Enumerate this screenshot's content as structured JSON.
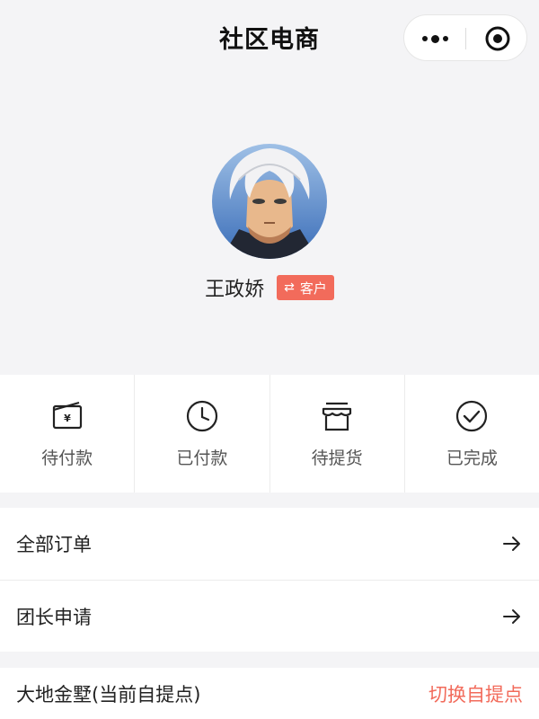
{
  "header": {
    "title": "社区电商",
    "more_icon": "more-dots-icon",
    "close_icon": "target-circle-icon"
  },
  "profile": {
    "name": "王政娇",
    "role_icon": "swap-icon",
    "role_badge": "客户",
    "badge_color": "#f26b5b"
  },
  "order_status": [
    {
      "label": "待付款",
      "icon": "wallet-yen-icon"
    },
    {
      "label": "已付款",
      "icon": "clock-icon"
    },
    {
      "label": "待提货",
      "icon": "store-icon"
    },
    {
      "label": "已完成",
      "icon": "check-circle-icon"
    }
  ],
  "menu": [
    {
      "label": "全部订单",
      "icon": "arrow-right-icon"
    },
    {
      "label": "团长申请",
      "icon": "arrow-right-icon"
    }
  ],
  "pickup": {
    "label": "大地金墅(当前自提点)",
    "action": "切换自提点",
    "action_color": "#f26b5b"
  }
}
